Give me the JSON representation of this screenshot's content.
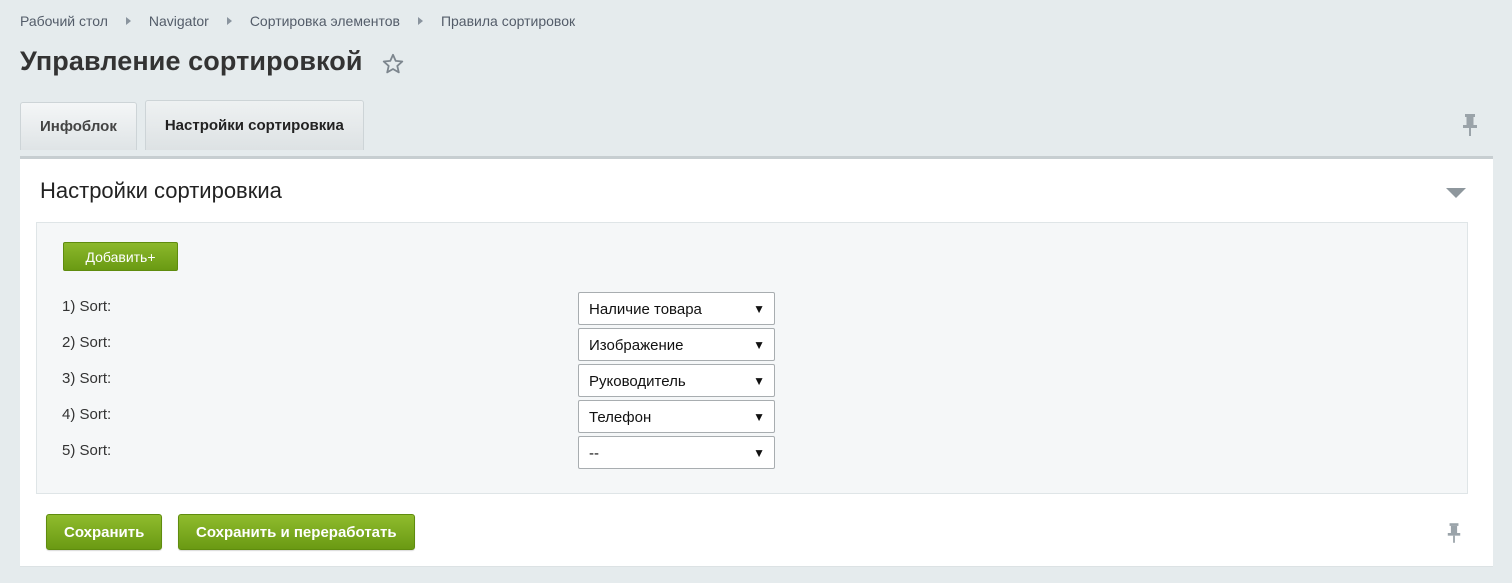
{
  "breadcrumb": [
    "Рабочий стол",
    "Navigator",
    "Сортировка элементов",
    "Правила сортировок"
  ],
  "page_title": "Управление сортировкой",
  "tabs": [
    {
      "label": "Инфоблок",
      "active": false
    },
    {
      "label": "Настройки сортировкиа",
      "active": true
    }
  ],
  "section": {
    "title": "Настройки сортировкиа",
    "add_label": "Добавить+"
  },
  "sort_rows": [
    {
      "label": "1) Sort:",
      "value": "Наличие товара"
    },
    {
      "label": "2) Sort:",
      "value": "Изображение"
    },
    {
      "label": "3) Sort:",
      "value": "Руководитель"
    },
    {
      "label": "4) Sort:",
      "value": "Телефон"
    },
    {
      "label": "5) Sort:",
      "value": "--"
    }
  ],
  "buttons": {
    "save": "Сохранить",
    "save_and_rework": "Сохранить и переработать"
  },
  "icons": {
    "favorite": "star-icon",
    "pin": "pin-icon",
    "collapse": "collapse-triangle-icon",
    "dropdown": "dropdown-arrow-icon"
  },
  "colors": {
    "accent_green": "#7aaa1f",
    "page_background": "#e5ebed"
  }
}
